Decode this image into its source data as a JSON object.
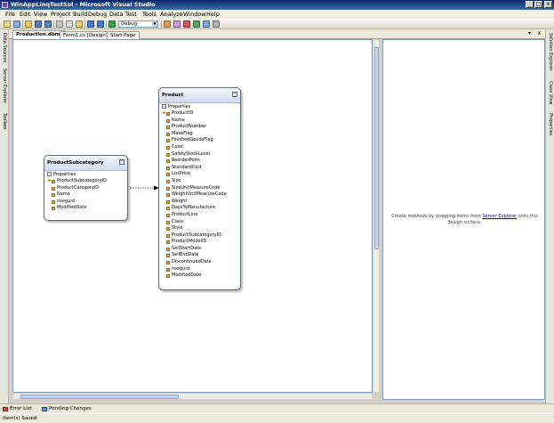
{
  "window": {
    "title": "WinAppLinqTestSol - Microsoft Visual Studio"
  },
  "menu": [
    "File",
    "Edit",
    "View",
    "Project",
    "Build",
    "Debug",
    "Data",
    "Test",
    "Tools",
    "Analyze",
    "Window",
    "Help"
  ],
  "toolbar": {
    "config": "Debug"
  },
  "left_tabs": [
    "Data Sources",
    "Server Explorer",
    "Toolbox"
  ],
  "right_tabs": [
    "Solution Explorer",
    "Class View",
    "Properties"
  ],
  "doc_tabs": [
    "Production.dbml",
    "Form1.cs [Design]",
    "Start Page"
  ],
  "entities": {
    "subcategory": {
      "title": "ProductSubcategory",
      "section": "Properties",
      "properties": [
        "ProductSubcategoryID",
        "ProductCategoryID",
        "Name",
        "rowguid",
        "ModifiedDate"
      ]
    },
    "product": {
      "title": "Product",
      "section": "Properties",
      "properties": [
        "ProductID",
        "Name",
        "ProductNumber",
        "MakeFlag",
        "FinishedGoodsFlag",
        "Color",
        "SafetyStockLevel",
        "ReorderPoint",
        "StandardCost",
        "ListPrice",
        "Size",
        "SizeUnitMeasureCode",
        "WeightUnitMeasureCode",
        "Weight",
        "DaysToManufacture",
        "ProductLine",
        "Class",
        "Style",
        "ProductSubcategoryID",
        "ProductModelID",
        "SellStartDate",
        "SellEndDate",
        "DiscontinuedDate",
        "rowguid",
        "ModifiedDate"
      ]
    }
  },
  "methods_pane": {
    "hint_before": "Create methods by dragging items from ",
    "hint_link": "Server Explorer",
    "hint_after": " onto this design surface."
  },
  "bottom_tabs": [
    "Error List",
    "Pending Changes"
  ],
  "status": "Item(s) Saved",
  "colors": {
    "title_bar": "#0a246a",
    "entity_header": "#cfdcf0",
    "key_icon": "#d4a017",
    "link": "#0000ee"
  }
}
